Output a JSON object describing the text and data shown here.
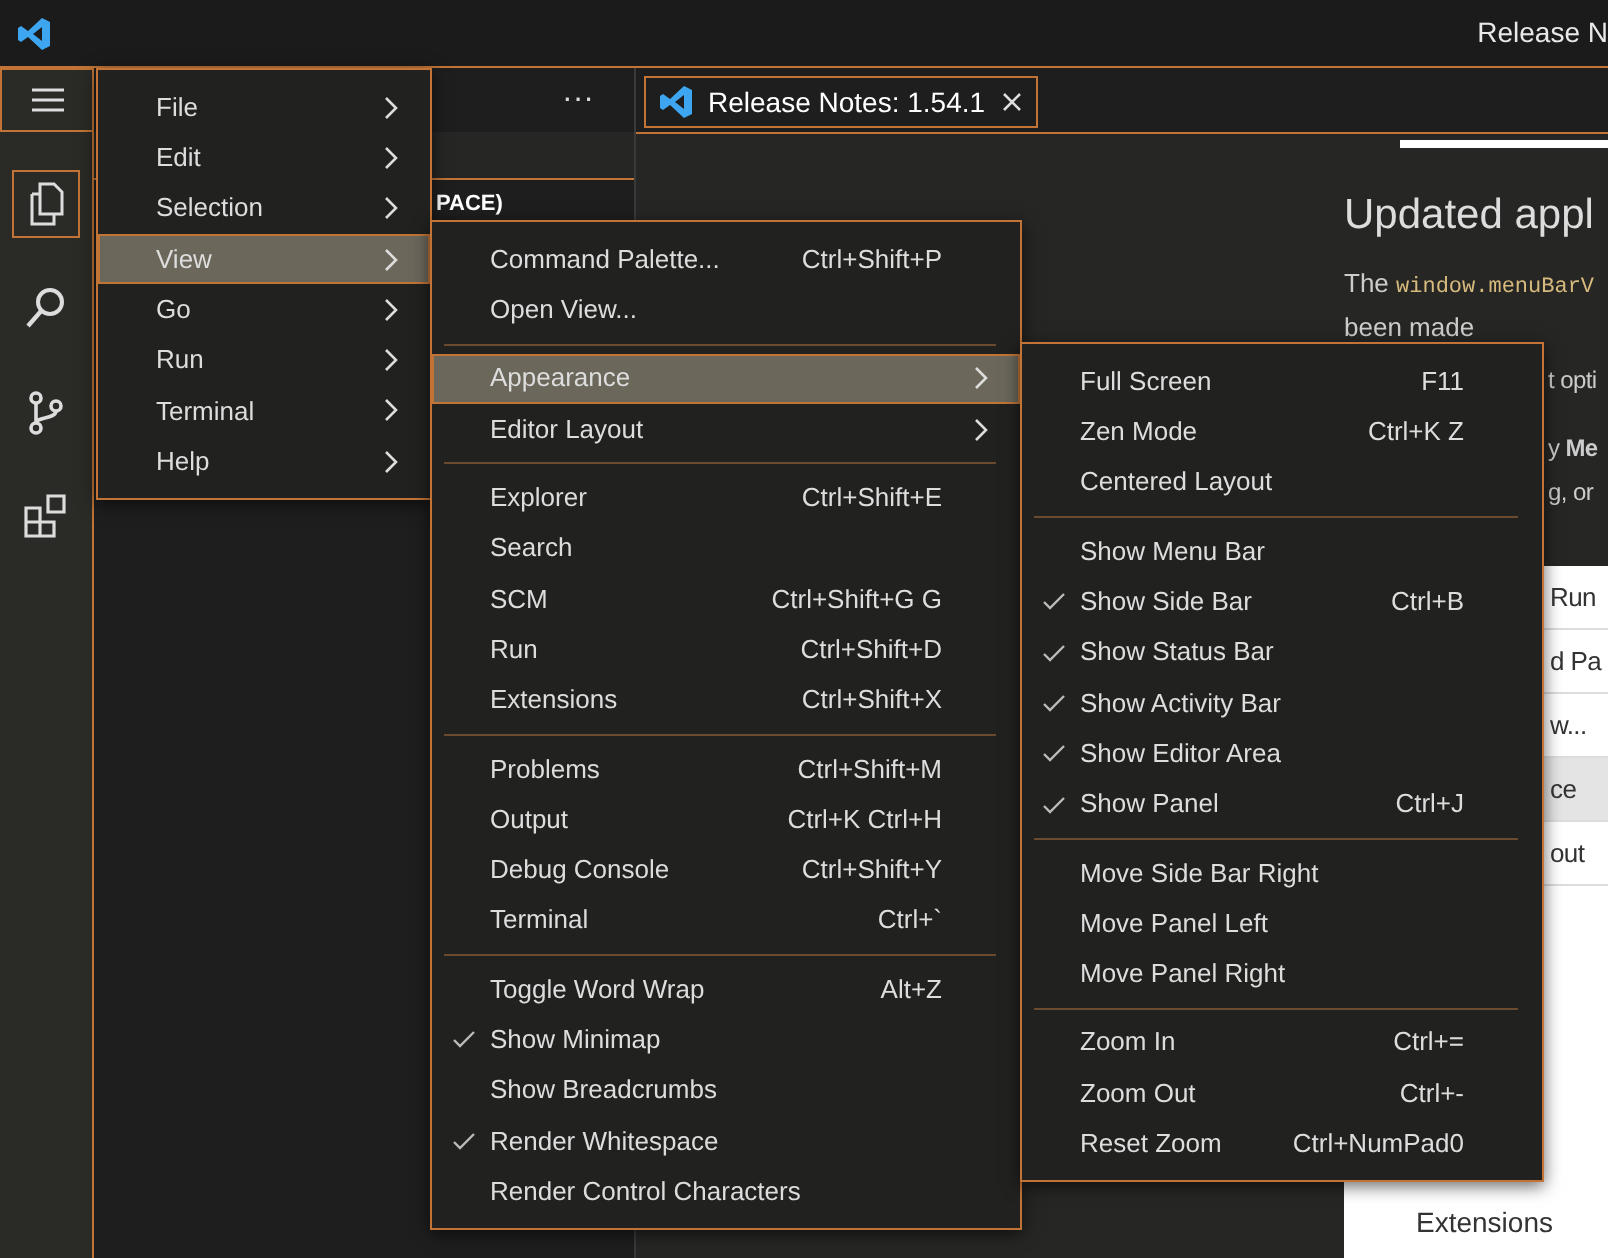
{
  "window": {
    "title": "Release N"
  },
  "activity_bar": [
    {
      "kind": "menu"
    },
    {
      "kind": "files",
      "selected": true
    },
    {
      "kind": "search",
      "selected": false
    },
    {
      "kind": "branch",
      "selected": false
    },
    {
      "kind": "blocks",
      "selected": false
    }
  ],
  "sidebar": {
    "more": "···",
    "header_fragment": "PACE)"
  },
  "tabs": [
    {
      "label": "Release Notes: 1.54.1",
      "selected": true
    }
  ],
  "editor": {
    "heading": "Updated appl",
    "code_line": {
      "text": "The",
      "code": "window.menuBarV"
    },
    "line_2": "been made",
    "fragments": [
      "t opti",
      "y **Me**",
      "g, or"
    ],
    "panel_items": [
      {
        "kind": "fragment",
        "label": "Run",
        "selected": false
      },
      {
        "kind": "fragment",
        "label": "d Pa",
        "selected": false
      },
      {
        "kind": "fragment",
        "label": "w...",
        "selected": false
      },
      {
        "kind": "fragment",
        "label": "ce",
        "selected": true
      },
      {
        "kind": "fragment",
        "label": "out",
        "selected": false
      },
      {
        "kind": "entry",
        "label": "Extensions",
        "selected": false
      }
    ]
  },
  "menu": [
    {
      "label": "File",
      "submenu": true,
      "selected": false
    },
    {
      "label": "Edit",
      "submenu": true,
      "selected": false
    },
    {
      "label": "Selection",
      "submenu": true,
      "selected": false
    },
    {
      "label": "View",
      "submenu": true,
      "selected": true
    },
    {
      "label": "Go",
      "submenu": true,
      "selected": false
    },
    {
      "label": "Run",
      "submenu": true,
      "selected": false
    },
    {
      "label": "Terminal",
      "submenu": true,
      "selected": false
    },
    {
      "label": "Help",
      "submenu": true,
      "selected": false
    }
  ],
  "view_menu": [
    [
      {
        "label": "Command Palette...",
        "shortcut": "Ctrl+Shift+P",
        "checked": false,
        "submenu": false,
        "selected": false
      },
      {
        "label": "Open View...",
        "checked": false,
        "submenu": false,
        "selected": false
      }
    ],
    [
      {
        "label": "Appearance",
        "checked": false,
        "submenu": true,
        "selected": true
      },
      {
        "label": "Editor Layout",
        "checked": false,
        "submenu": true,
        "selected": false
      }
    ],
    [
      {
        "label": "Explorer",
        "shortcut": "Ctrl+Shift+E",
        "checked": false,
        "submenu": false,
        "selected": false
      },
      {
        "label": "Search",
        "checked": false,
        "submenu": false,
        "selected": false
      },
      {
        "label": "SCM",
        "shortcut": "Ctrl+Shift+G G",
        "checked": false,
        "submenu": false,
        "selected": false
      },
      {
        "label": "Run",
        "shortcut": "Ctrl+Shift+D",
        "checked": false,
        "submenu": false,
        "selected": false
      },
      {
        "label": "Extensions",
        "shortcut": "Ctrl+Shift+X",
        "checked": false,
        "submenu": false,
        "selected": false
      }
    ],
    [
      {
        "label": "Problems",
        "shortcut": "Ctrl+Shift+M",
        "checked": false,
        "submenu": false,
        "selected": false
      },
      {
        "label": "Output",
        "shortcut": "Ctrl+K Ctrl+H",
        "checked": false,
        "submenu": false,
        "selected": false
      },
      {
        "label": "Debug Console",
        "shortcut": "Ctrl+Shift+Y",
        "checked": false,
        "submenu": false,
        "selected": false
      },
      {
        "label": "Terminal",
        "shortcut": "Ctrl+`",
        "checked": false,
        "submenu": false,
        "selected": false
      }
    ],
    [
      {
        "label": "Toggle Word Wrap",
        "shortcut": "Alt+Z",
        "checked": false,
        "submenu": false,
        "selected": false
      },
      {
        "label": "Show Minimap",
        "checked": true,
        "submenu": false,
        "selected": false
      },
      {
        "label": "Show Breadcrumbs",
        "checked": false,
        "submenu": false,
        "selected": false
      },
      {
        "label": "Render Whitespace",
        "checked": true,
        "submenu": false,
        "selected": false
      },
      {
        "label": "Render Control Characters",
        "checked": false,
        "submenu": false,
        "selected": false
      }
    ]
  ],
  "appearance_menu": [
    [
      {
        "label": "Full Screen",
        "shortcut": "F11",
        "checked": false,
        "selected": false
      },
      {
        "label": "Zen Mode",
        "shortcut": "Ctrl+K Z",
        "checked": false,
        "selected": false
      },
      {
        "label": "Centered Layout",
        "checked": false,
        "selected": false
      }
    ],
    [
      {
        "label": "Show Menu Bar",
        "checked": false,
        "selected": false
      },
      {
        "label": "Show Side Bar",
        "shortcut": "Ctrl+B",
        "checked": true,
        "selected": false
      },
      {
        "label": "Show Status Bar",
        "checked": true,
        "selected": false
      },
      {
        "label": "Show Activity Bar",
        "checked": true,
        "selected": false
      },
      {
        "label": "Show Editor Area",
        "checked": true,
        "selected": false
      },
      {
        "label": "Show Panel",
        "shortcut": "Ctrl+J",
        "checked": true,
        "selected": false
      }
    ],
    [
      {
        "label": "Move Side Bar Right",
        "checked": false,
        "selected": false
      },
      {
        "label": "Move Panel Left",
        "checked": false,
        "selected": false
      },
      {
        "label": "Move Panel Right",
        "checked": false,
        "selected": false
      }
    ],
    [
      {
        "label": "Zoom In",
        "shortcut": "Ctrl+=",
        "checked": false,
        "selected": false
      },
      {
        "label": "Zoom Out",
        "shortcut": "Ctrl+-",
        "checked": false,
        "selected": false
      },
      {
        "label": "Reset Zoom",
        "shortcut": "Ctrl+NumPad0",
        "checked": false,
        "selected": false
      }
    ]
  ]
}
